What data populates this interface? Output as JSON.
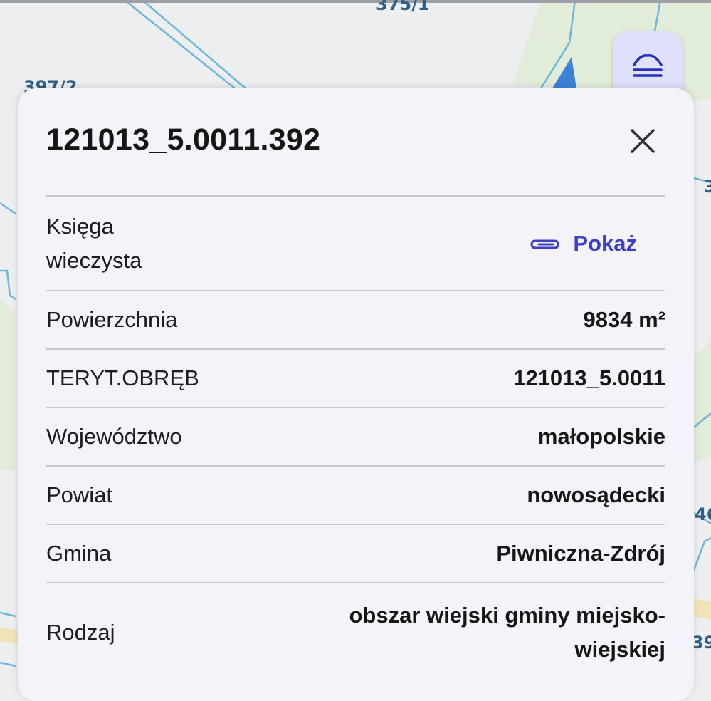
{
  "map": {
    "labels": [
      "375/1",
      "397/2",
      "3",
      "46",
      "39"
    ]
  },
  "layers_button": {
    "icon": "layers-icon"
  },
  "panel": {
    "title": "121013_5.0011.392",
    "close_icon": "close-icon",
    "rows": [
      {
        "label": "Księga wieczysta",
        "link_icon": "paperclip-icon",
        "link_text": "Pokaż"
      },
      {
        "label": "Powierzchnia",
        "value": "9834 m²"
      },
      {
        "label": "TERYT.OBRĘB",
        "value": "121013_5.0011"
      },
      {
        "label": "Województwo",
        "value": "małopolskie"
      },
      {
        "label": "Powiat",
        "value": "nowosądecki"
      },
      {
        "label": "Gmina",
        "value": "Piwniczna-Zdrój"
      },
      {
        "label": "Rodzaj",
        "value": "obszar wiejski gminy miejsko-wiejskiej"
      }
    ]
  },
  "colors": {
    "accent": "#3c40c6",
    "panel": "#f3f3f9",
    "map_line": "#6fb6d8",
    "map_green": "#e1ecd9"
  }
}
